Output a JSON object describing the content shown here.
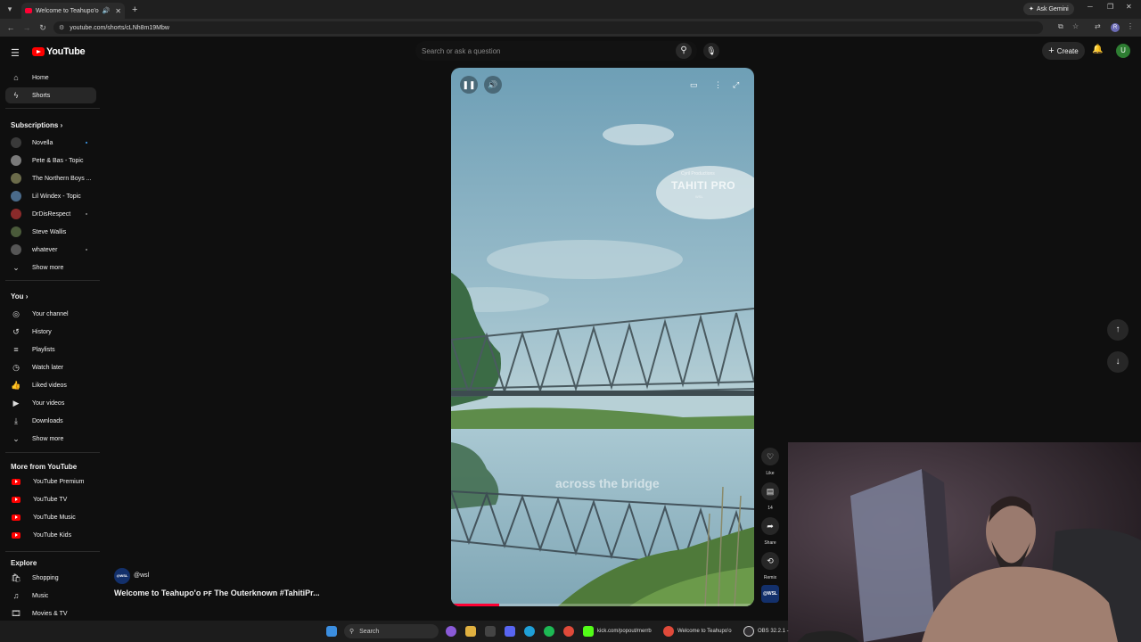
{
  "browser": {
    "tab_title": "Welcome to Teahupo'o ᴘꜰ",
    "url": "youtube.com/shorts/cLNh8m19Mbw",
    "ask_gemini": "Ask Gemini",
    "profile_initial": "R"
  },
  "header": {
    "logo_text": "YouTube",
    "search_placeholder": "Search or ask a question",
    "create_label": "Create",
    "avatar_initial": "U"
  },
  "sidebar": {
    "main": [
      {
        "label": "Home",
        "icon": "home-icon"
      },
      {
        "label": "Shorts",
        "icon": "shorts-icon"
      }
    ],
    "subscriptions_heading": "Subscriptions",
    "subscriptions": [
      {
        "label": "Novella",
        "color": "#3a3a3a",
        "dot": "blue"
      },
      {
        "label": "Pete & Bas - Topic",
        "color": "#7a7a7a",
        "dot": ""
      },
      {
        "label": "The Northern Boys ...",
        "color": "#6b6b4a",
        "dot": ""
      },
      {
        "label": "Lil Windex - Topic",
        "color": "#4a6a8a",
        "dot": ""
      },
      {
        "label": "DrDisRespect",
        "color": "#8a2a2a",
        "dot": "grey"
      },
      {
        "label": "Steve Wallis",
        "color": "#4a5a3a",
        "dot": ""
      },
      {
        "label": "whatever",
        "color": "#555555",
        "dot": "grey"
      }
    ],
    "show_more": "Show more",
    "you_heading": "You",
    "you_items": [
      {
        "label": "Your channel",
        "icon": "channel-icon"
      },
      {
        "label": "History",
        "icon": "history-icon"
      },
      {
        "label": "Playlists",
        "icon": "playlists-icon"
      },
      {
        "label": "Watch later",
        "icon": "watch-later-icon"
      },
      {
        "label": "Liked videos",
        "icon": "like-icon"
      },
      {
        "label": "Your videos",
        "icon": "video-icon"
      },
      {
        "label": "Downloads",
        "icon": "download-icon"
      }
    ],
    "show_more_2": "Show more",
    "more_heading": "More from YouTube",
    "more_items": [
      {
        "label": "YouTube Premium"
      },
      {
        "label": "YouTube TV"
      },
      {
        "label": "YouTube Music"
      },
      {
        "label": "YouTube Kids"
      }
    ],
    "explore_heading": "Explore",
    "explore_items": [
      {
        "label": "Shopping",
        "icon": "shopping-icon"
      },
      {
        "label": "Music",
        "icon": "music-icon"
      },
      {
        "label": "Movies & TV",
        "icon": "movies-icon"
      }
    ]
  },
  "player": {
    "watermark_small": "Cyril Productions",
    "watermark_big": "TAHITI PRO",
    "watermark_sub": "WSL",
    "caption": "across the bridge",
    "progress": 0.16
  },
  "actions": {
    "like": "Like",
    "comments": "14",
    "share": "Share",
    "remix": "Remix",
    "channel_badge": "@WSL"
  },
  "meta": {
    "channel_badge": "@WSL",
    "handle": "@wsl",
    "title": "Welcome to Teahupo'o ᴘꜰ The Outerknown #TahitiPr..."
  },
  "taskbar": {
    "search": "Search",
    "kick": "kick.com/popout/merrb",
    "welcome": "Welcome to Teahupo'o",
    "obs": "OBS 32.2.1 -"
  }
}
